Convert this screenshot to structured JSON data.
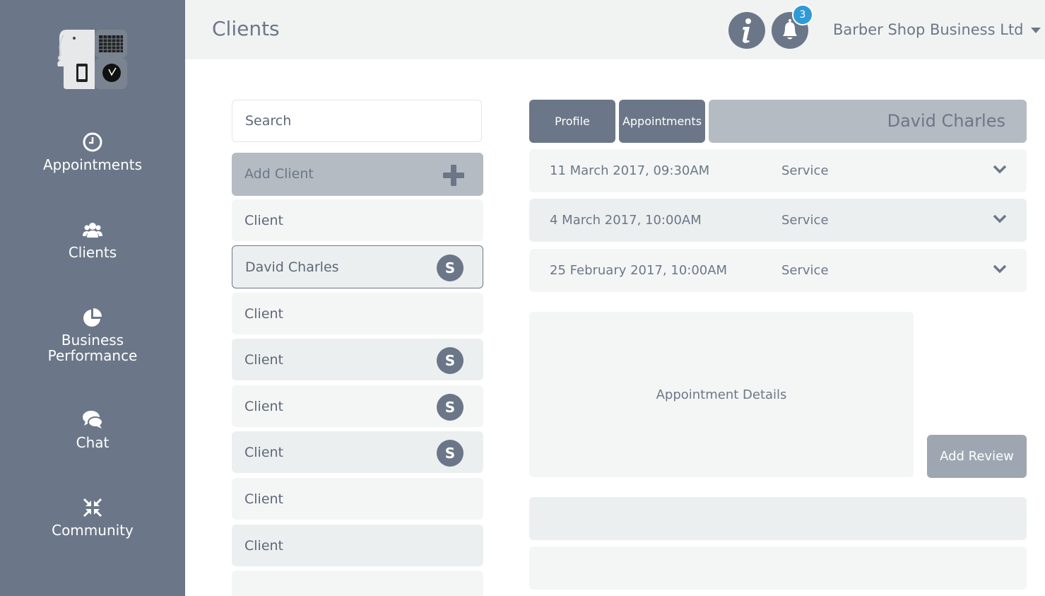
{
  "sidebar": {
    "logo_icon": "elephant-devices-logo",
    "items": [
      {
        "label": "Appointments",
        "icon": "clock-icon"
      },
      {
        "label": "Clients",
        "icon": "users-icon"
      },
      {
        "label": "Business\nPerformance",
        "label_line1": "Business",
        "label_line2": "Performance",
        "icon": "pie-chart-icon"
      },
      {
        "label": "Chat",
        "icon": "chat-bubbles-icon"
      },
      {
        "label": "Community",
        "icon": "compress-arrows-icon"
      }
    ]
  },
  "header": {
    "title": "Clients",
    "info_icon": "info-icon",
    "notifications_icon": "bell-icon",
    "notification_count": "3",
    "business_name": "Barber Shop Business Ltd"
  },
  "client_list": {
    "search_placeholder": "Search",
    "add_client_label": "Add Client",
    "rows": [
      {
        "label": "Client",
        "badge": ""
      },
      {
        "label": "David Charles",
        "badge": "S"
      },
      {
        "label": "Client",
        "badge": ""
      },
      {
        "label": "Client",
        "badge": "S"
      },
      {
        "label": "Client",
        "badge": "S"
      },
      {
        "label": "Client",
        "badge": "S"
      },
      {
        "label": "Client",
        "badge": ""
      },
      {
        "label": "Client",
        "badge": ""
      }
    ]
  },
  "detail": {
    "tabs": [
      {
        "label": "Profile"
      },
      {
        "label": "Appointments"
      }
    ],
    "client_name": "David Charles",
    "appointments": [
      {
        "date": "11 March 2017, 09:30AM",
        "service": "Service"
      },
      {
        "date": "4 March 2017, 10:00AM",
        "service": "Service"
      },
      {
        "date": "25 February 2017, 10:00AM",
        "service": "Service"
      }
    ],
    "details_label": "Appointment Details",
    "add_review_label": "Add Review"
  },
  "colors": {
    "sidebar": "#6b7788",
    "accent_badge": "#2f9ad6",
    "text": "#6c7787"
  }
}
